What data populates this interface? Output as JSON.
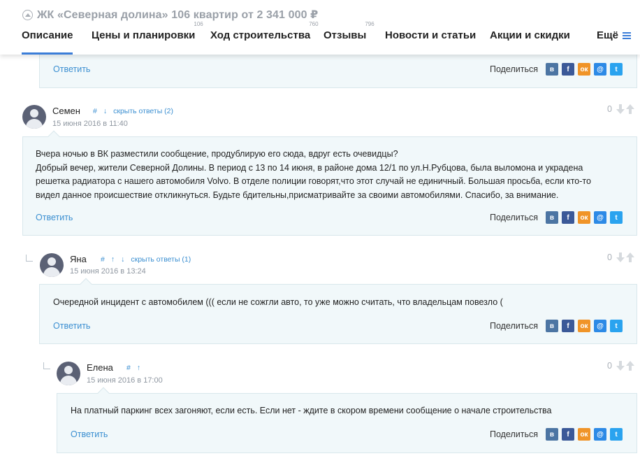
{
  "header": {
    "title": "ЖК «Северная долина» 106 квартир от 2 341 000 ₽",
    "tabs": [
      {
        "label": "Описание",
        "count": ""
      },
      {
        "label": "Цены и планировки",
        "count": "106"
      },
      {
        "label": "Ход строительства",
        "count": "760"
      },
      {
        "label": "Отзывы",
        "count": "796"
      },
      {
        "label": "Новости и статьи",
        "count": ""
      },
      {
        "label": "Акции и скидки",
        "count": ""
      },
      {
        "label": "Ещё",
        "count": ""
      }
    ]
  },
  "share_label": "Поделиться",
  "reply_label": "Ответить",
  "share_icons": [
    "vk-icon",
    "facebook-icon",
    "odnoklassniki-icon",
    "mailru-icon",
    "twitter-icon"
  ],
  "colors": {
    "accent": "#3b7dd8",
    "link": "#3b8fd1",
    "box_bg": "#f1f8fa"
  },
  "comments": [
    {
      "author": "Семен",
      "date": "15 июня 2016 в 11:40",
      "links": [
        "#",
        "↓",
        "скрыть ответы (2)"
      ],
      "votes": "0",
      "text": "Вчера ночью в ВК разместили сообщение, продублирую его сюда, вдруг есть очевидцы?\nДобрый вечер, жители Северной Долины. В период с 13 по 14 июня, в районе дома 12/1 по ул.Н.Рубцова, была выломона и украдена решетка радиатора с нашего автомобиля Volvo. В отделе полиции говорят,что этот случай не единичный. Большая просьба, если кто-то видел данное происшествие откликнуться. Будьте бдительны,присматривайте за своими автомобилями. Спасибо, за внимание."
    },
    {
      "author": "Яна",
      "date": "15 июня 2016 в 13:24",
      "links": [
        "#",
        "↑",
        "↓",
        "скрыть ответы (1)"
      ],
      "votes": "0",
      "text": "Очередной инцидент с автомобилем ((( если не сожгли авто, то уже можно считать, что владельцам повезло ("
    },
    {
      "author": "Елена",
      "date": "15 июня 2016 в 17:00",
      "links": [
        "#",
        "↑"
      ],
      "votes": "0",
      "text": "На платный паркинг всех загоняют, если есть. Если нет - ждите в скором времени сообщение о начале строительства"
    }
  ]
}
